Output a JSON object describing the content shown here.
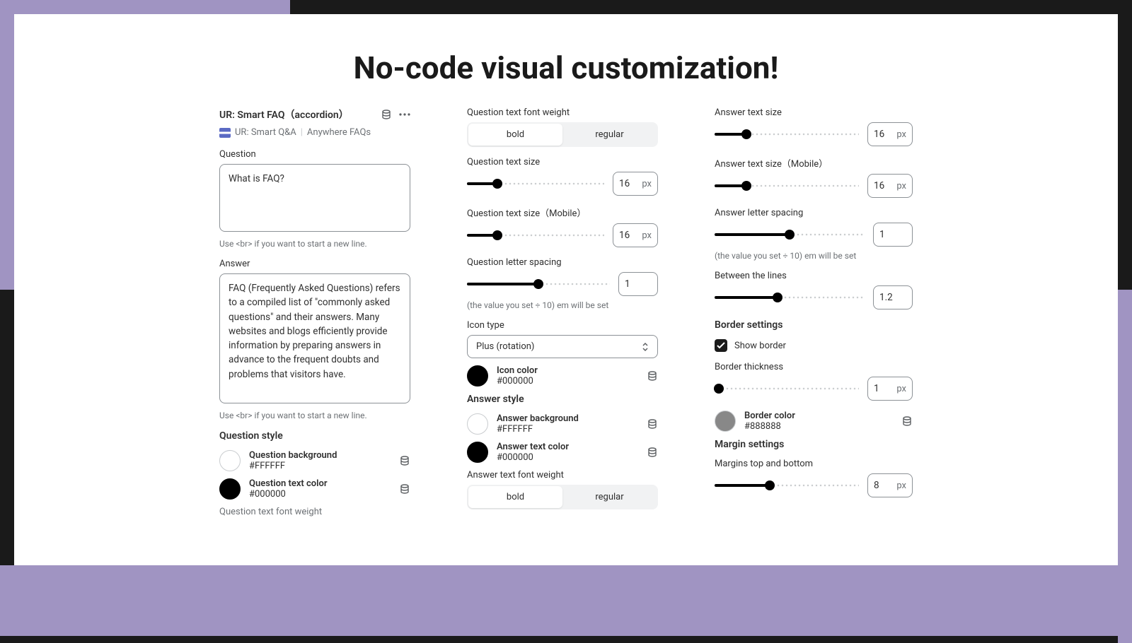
{
  "title": "No-code visual customization!",
  "panel1": {
    "title": "UR: Smart FAQ（accordion）",
    "crumb1": "UR: Smart Q&A",
    "crumb2": "Anywhere FAQs",
    "question_label": "Question",
    "question_value": "What is FAQ?",
    "hint": "Use <br> if you want to start a new line.",
    "answer_label": "Answer",
    "answer_value": "FAQ (Frequently Asked Questions) refers to a compiled list of \"commonly asked questions\" and their answers. Many websites and blogs efficiently provide information by preparing answers in advance to the frequent doubts and problems that visitors have.",
    "qstyle_h": "Question style",
    "qbg_name": "Question background",
    "qbg_hex": "#FFFFFF",
    "qtc_name": "Question text color",
    "qtc_hex": "#000000",
    "trunc": "Question text font weight"
  },
  "panel2": {
    "qfw_label": "Question text font weight",
    "bold": "bold",
    "regular": "regular",
    "qts_label": "Question text size",
    "qts_val": "16",
    "qtsm_label": "Question text size（Mobile）",
    "qtsm_val": "16",
    "qls_label": "Question letter spacing",
    "qls_val": "1",
    "spacing_hint": "(the value you set ÷ 10) em will be set",
    "icon_type_label": "Icon type",
    "icon_type_val": "Plus (rotation)",
    "icon_color_name": "Icon color",
    "icon_color_hex": "#000000",
    "astyle_h": "Answer style",
    "abg_name": "Answer background",
    "abg_hex": "#FFFFFF",
    "atc_name": "Answer text color",
    "atc_hex": "#000000",
    "afw_label": "Answer text font weight"
  },
  "panel3": {
    "ats_label": "Answer text size",
    "ats_val": "16",
    "atsm_label": "Answer text size（Mobile）",
    "atsm_val": "16",
    "als_label": "Answer letter spacing",
    "als_val": "1",
    "spacing_hint": "(the value you set ÷ 10) em will be set",
    "btl_label": "Between the lines",
    "btl_val": "1.2",
    "border_h": "Border settings",
    "show_border": "Show border",
    "bt_label": "Border thickness",
    "bt_val": "1",
    "bc_name": "Border color",
    "bc_hex": "#888888",
    "margin_h": "Margin settings",
    "mtb_label": "Margins top and bottom",
    "mtb_val": "8"
  },
  "px": "px"
}
